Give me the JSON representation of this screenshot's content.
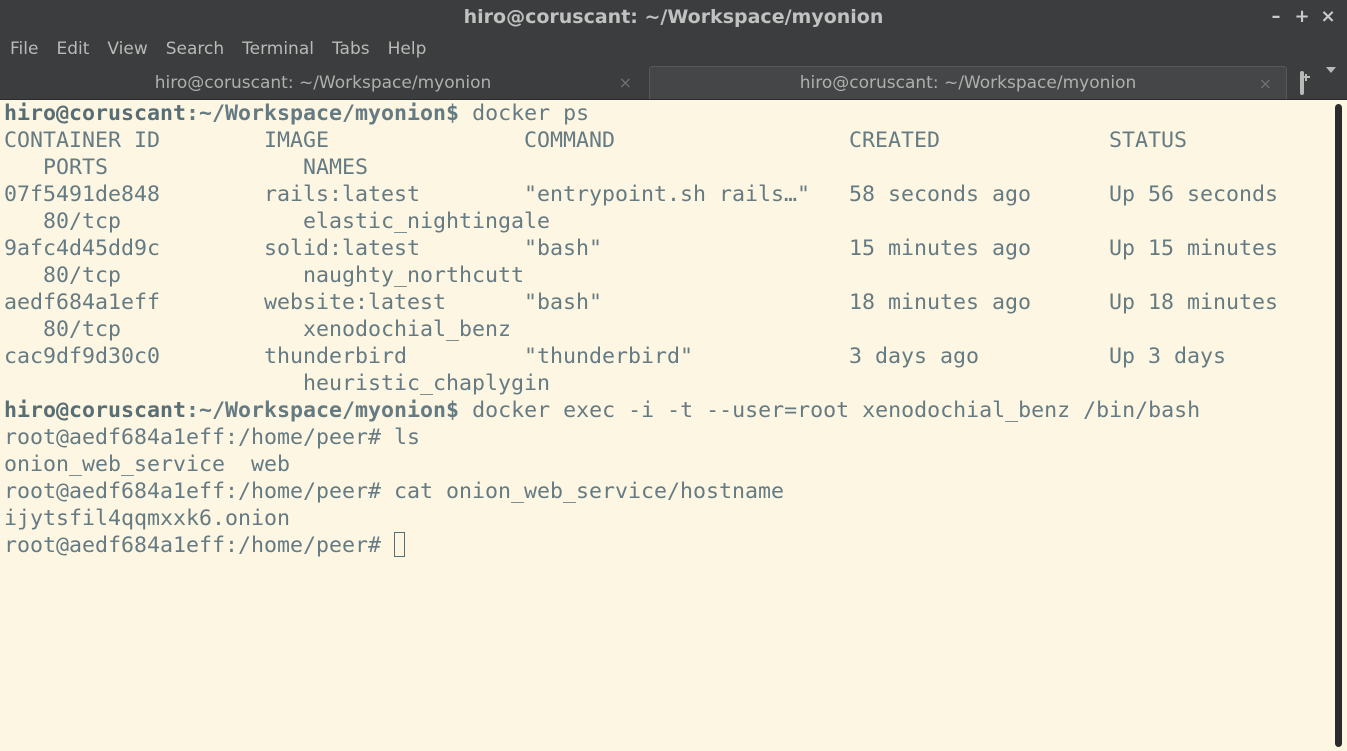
{
  "window": {
    "title": "hiro@coruscant: ~/Workspace/myonion",
    "controls": {
      "minimize": "–",
      "maximize": "+",
      "close": "×"
    }
  },
  "menu": [
    "File",
    "Edit",
    "View",
    "Search",
    "Terminal",
    "Tabs",
    "Help"
  ],
  "tabs": [
    {
      "label": "hiro@coruscant: ~/Workspace/myonion",
      "close": "×",
      "active": false
    },
    {
      "label": "hiro@coruscant: ~/Workspace/myonion",
      "close": "×",
      "active": true
    }
  ],
  "terminal": {
    "prompt_user": "hiro@coruscant",
    "prompt_sep": ":",
    "prompt_path": "~/Workspace/myonion",
    "prompt_end": "$ ",
    "lines": [
      {
        "kind": "prompt",
        "cmd": "docker ps"
      },
      {
        "kind": "text",
        "text": "CONTAINER ID        IMAGE               COMMAND                  CREATED             STATUS"
      },
      {
        "kind": "text",
        "text": "   PORTS               NAMES"
      },
      {
        "kind": "text",
        "text": "07f5491de848        rails:latest        \"entrypoint.sh rails…\"   58 seconds ago      Up 56 seconds"
      },
      {
        "kind": "text",
        "text": "   80/tcp              elastic_nightingale"
      },
      {
        "kind": "text",
        "text": "9afc4d45dd9c        solid:latest        \"bash\"                   15 minutes ago      Up 15 minutes"
      },
      {
        "kind": "text",
        "text": "   80/tcp              naughty_northcutt"
      },
      {
        "kind": "text",
        "text": "aedf684a1eff        website:latest      \"bash\"                   18 minutes ago      Up 18 minutes"
      },
      {
        "kind": "text",
        "text": "   80/tcp              xenodochial_benz"
      },
      {
        "kind": "text",
        "text": "cac9df9d30c0        thunderbird         \"thunderbird\"            3 days ago          Up 3 days"
      },
      {
        "kind": "text",
        "text": "                       heuristic_chaplygin"
      },
      {
        "kind": "prompt",
        "cmd": "docker exec -i -t --user=root xenodochial_benz /bin/bash"
      },
      {
        "kind": "text",
        "text": "root@aedf684a1eff:/home/peer# ls"
      },
      {
        "kind": "text",
        "text": "onion_web_service  web"
      },
      {
        "kind": "text",
        "text": "root@aedf684a1eff:/home/peer# cat onion_web_service/hostname"
      },
      {
        "kind": "text",
        "text": "ijytsfil4qqmxxk6.onion"
      },
      {
        "kind": "cursor",
        "text": "root@aedf684a1eff:/home/peer# "
      }
    ]
  },
  "colors": {
    "terminal_bg": "#fdf6e3",
    "terminal_fg": "#657b83",
    "chrome_bg": "#3b3d3e"
  }
}
